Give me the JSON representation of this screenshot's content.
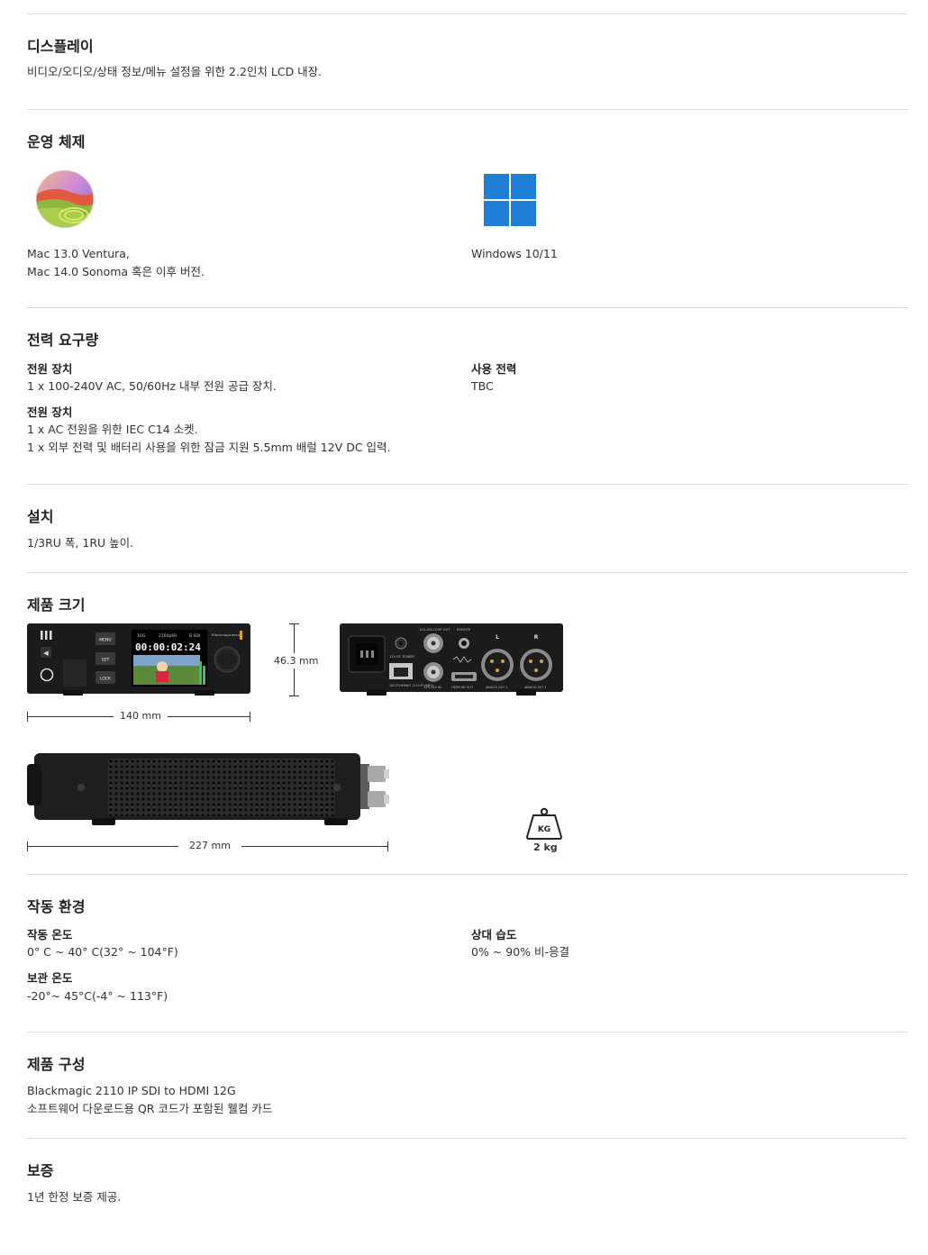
{
  "display": {
    "title": "디스플레이",
    "text": "비디오/오디오/상태 정보/메뉴 설정을 위한 2.2인치 LCD 내장."
  },
  "os": {
    "title": "운영 체제",
    "mac": {
      "icon": "macos-sonoma-icon",
      "line1": "Mac 13.0 Ventura,",
      "line2": "Mac 14.0 Sonoma 혹은 이후 버전."
    },
    "windows": {
      "icon": "windows-logo-icon",
      "line1": "Windows 10/11"
    }
  },
  "power": {
    "title": "전력 요구량",
    "supply1": {
      "label": "전원 장치",
      "text": "1 x 100-240V AC, 50/60Hz 내부 전원 공급 장치."
    },
    "usage": {
      "label": "사용 전력",
      "text": "TBC"
    },
    "supply2": {
      "label": "전원 장치",
      "line1": "1 x AC 전원을 위한 IEC C14 소켓.",
      "line2": "1 x 외부 전력 및 배터리 사용을 위한 잠금 지원 5.5mm 배럴 12V DC 입력."
    }
  },
  "install": {
    "title": "설치",
    "text": "1/3RU 폭, 1RU 높이."
  },
  "dimensions": {
    "title": "제품 크기",
    "width": "140 mm",
    "height": "46.3 mm",
    "depth": "227 mm",
    "weight_badge": "KG",
    "weight": "2 kg",
    "front_panel": {
      "menu": "MENU",
      "set": "SET",
      "lock": "LOCK",
      "timecode": "00:00:02:24",
      "status_a": "10G",
      "status_b": "2160p60",
      "status_c": "B SDI",
      "brand": "Blackmagicdesign"
    },
    "rear_panel": {
      "loop_out": "12G-SDI LOOP OUT",
      "remote": "REMOTE",
      "dc_power": "12V DC POWER",
      "ethernet": "10G ETHERNET 2110 IP VIDEO",
      "sdi_in": "12G-SDI IN",
      "hdmi_out": "HDMI 4K OUT",
      "audio_out1": "ANALOG OUT 1",
      "audio_out2": "ANALOG OUT 2",
      "left": "L",
      "right": "R"
    }
  },
  "environment": {
    "title": "작동 환경",
    "op_temp": {
      "label": "작동 온도",
      "text": "0° C ~ 40° C(32° ~ 104°F)"
    },
    "humidity": {
      "label": "상대 습도",
      "text": "0% ~ 90% 비-응결"
    },
    "storage_temp": {
      "label": "보관 온도",
      "text": "-20°~ 45°C(-4° ~ 113°F)"
    }
  },
  "contents": {
    "title": "제품 구성",
    "line1": "Blackmagic 2110 IP SDI to HDMI 12G",
    "line2": "소프트웨어 다운로드용 QR 코드가 포함된 웰컴 카드"
  },
  "warranty": {
    "title": "보증",
    "text": "1년 한정 보증 제공."
  },
  "colors": {
    "divider": "#dcdcdc",
    "text": "#333333",
    "windows_blue": "#1f7fd6",
    "device_body": "#1b1b1d"
  }
}
